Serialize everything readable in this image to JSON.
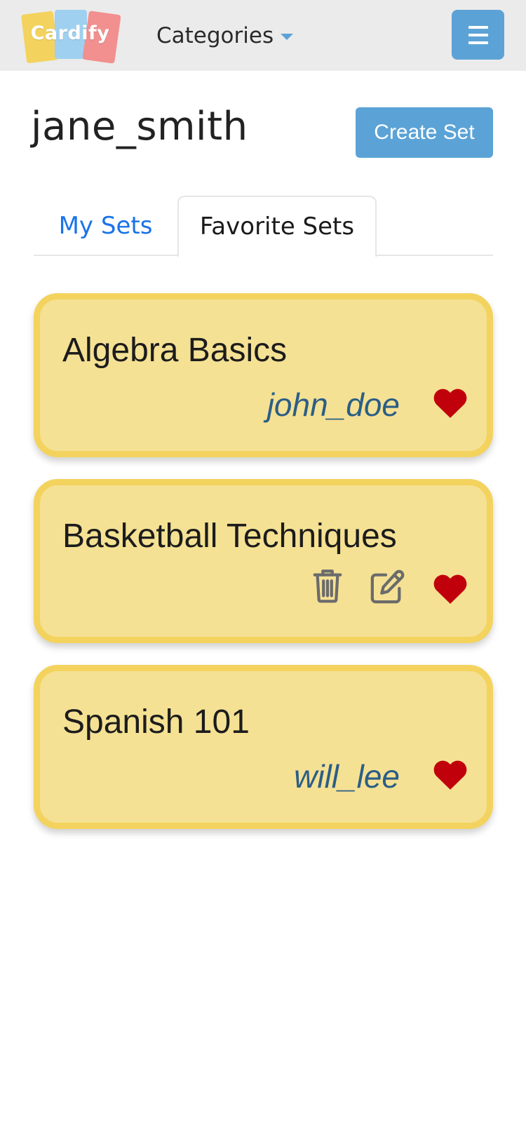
{
  "brand": {
    "logo_text": "Cardify"
  },
  "nav": {
    "categories_label": "Categories"
  },
  "profile": {
    "username": "jane_smith",
    "create_set_label": "Create Set"
  },
  "tabs": [
    {
      "label": "My Sets",
      "active": false
    },
    {
      "label": "Favorite Sets",
      "active": true
    }
  ],
  "sets": [
    {
      "title": "Algebra Basics",
      "author": "john_doe",
      "favorited": true,
      "owned": false
    },
    {
      "title": "Basketball Techniques",
      "author": "",
      "favorited": true,
      "owned": true
    },
    {
      "title": "Spanish 101",
      "author": "will_lee",
      "favorited": true,
      "owned": false
    }
  ],
  "colors": {
    "accent": "#5ba3d6",
    "card_bg": "#f5e194",
    "card_border": "#f3d35e",
    "heart": "#c0000b",
    "author": "#2b5e86",
    "tab_link": "#1a73e8"
  },
  "icons": {
    "menu": "hamburger-icon",
    "caret": "caret-down-icon",
    "favorite": "heart-icon",
    "delete": "trash-icon",
    "edit": "edit-icon"
  }
}
